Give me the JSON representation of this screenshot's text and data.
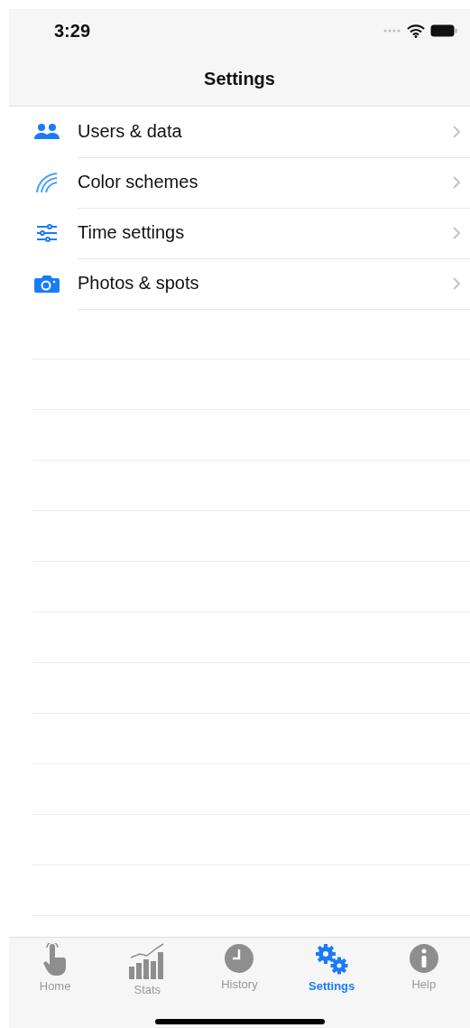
{
  "status_bar": {
    "time": "3:29"
  },
  "nav_bar": {
    "title": "Settings"
  },
  "settings_list": [
    {
      "label": "Users & data"
    },
    {
      "label": "Color schemes"
    },
    {
      "label": "Time settings"
    },
    {
      "label": "Photos & spots"
    }
  ],
  "tab_bar": [
    {
      "label": "Home",
      "selected": false
    },
    {
      "label": "Stats",
      "selected": false
    },
    {
      "label": "History",
      "selected": false
    },
    {
      "label": "Settings",
      "selected": true
    },
    {
      "label": "Help",
      "selected": false
    }
  ]
}
